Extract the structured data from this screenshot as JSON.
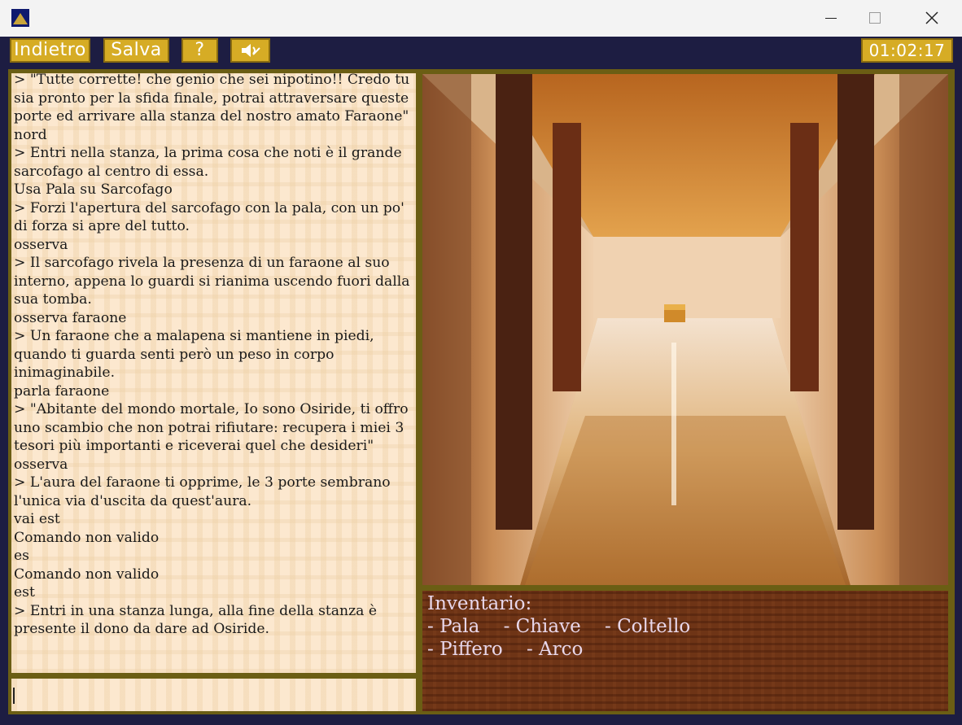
{
  "toolbar": {
    "back_label": "Indietro",
    "save_label": "Salva",
    "help_label": "?",
    "timer": "01:02:17"
  },
  "log": [
    "> \"Tutte corrette! che genio che sei nipotino!! Credo tu sia pronto per la sfida finale, potrai attraversare queste porte ed arrivare alla stanza del nostro amato Faraone\"",
    "nord",
    "> Entri nella stanza, la prima cosa che noti è il grande sarcofago al centro di essa.",
    "Usa Pala su Sarcofago",
    "> Forzi l'apertura del sarcofago con la pala, con un po' di forza si apre del tutto.",
    "osserva",
    "> Il sarcofago rivela la presenza di un faraone al suo interno, appena lo guardi si rianima uscendo fuori dalla sua tomba.",
    "osserva faraone",
    "> Un faraone che a malapena si mantiene in piedi, quando ti guarda senti però un peso in corpo inimaginabile.",
    "parla faraone",
    "> \"Abitante del mondo mortale, Io sono Osiride, ti offro uno scambio che non potrai rifiutare: recupera i miei 3 tesori più importanti e riceverai quel che desideri\"",
    "osserva",
    "> L'aura del faraone ti opprime, le 3 porte sembrano l'unica via d'uscita da quest'aura.",
    "vai est",
    "Comando non valido",
    "es",
    "Comando non valido",
    "est",
    "> Entri in una stanza lunga, alla fine della stanza è presente il dono da dare ad Osiride."
  ],
  "input": {
    "value": ""
  },
  "inventory": {
    "title": "Inventario:",
    "row1": [
      "- Pala",
      "- Chiave",
      "- Coltello"
    ],
    "row2": [
      "- Piffero",
      "- Arco"
    ]
  }
}
